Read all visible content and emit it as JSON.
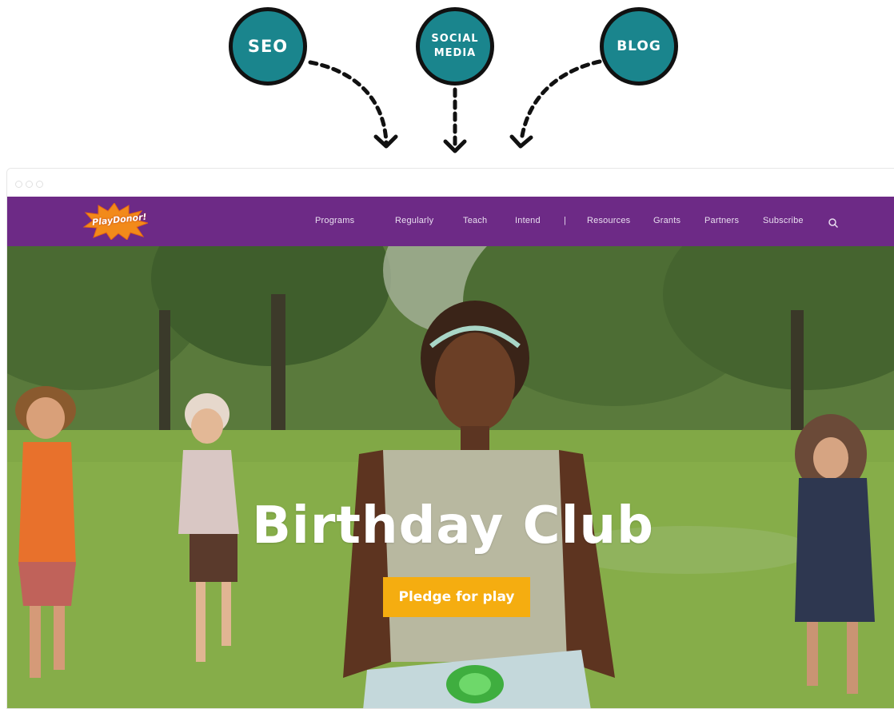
{
  "callouts": {
    "seo": "SEO",
    "social_line1": "SOCIAL",
    "social_line2": "MEDIA",
    "blog": "BLOG"
  },
  "site": {
    "logo_text": "PlayDonor!",
    "nav": [
      "Programs",
      "Regularly",
      "Teach",
      "Intend",
      "|",
      "Resources",
      "Grants",
      "Partners",
      "Subscribe"
    ],
    "search_icon": "search-icon"
  },
  "hero": {
    "title": "Birthday Club",
    "cta_label": "Pledge for play"
  },
  "colors": {
    "circle": "#1a858d",
    "nav_bg": "#6d2a86",
    "cta": "#f5ad10"
  }
}
